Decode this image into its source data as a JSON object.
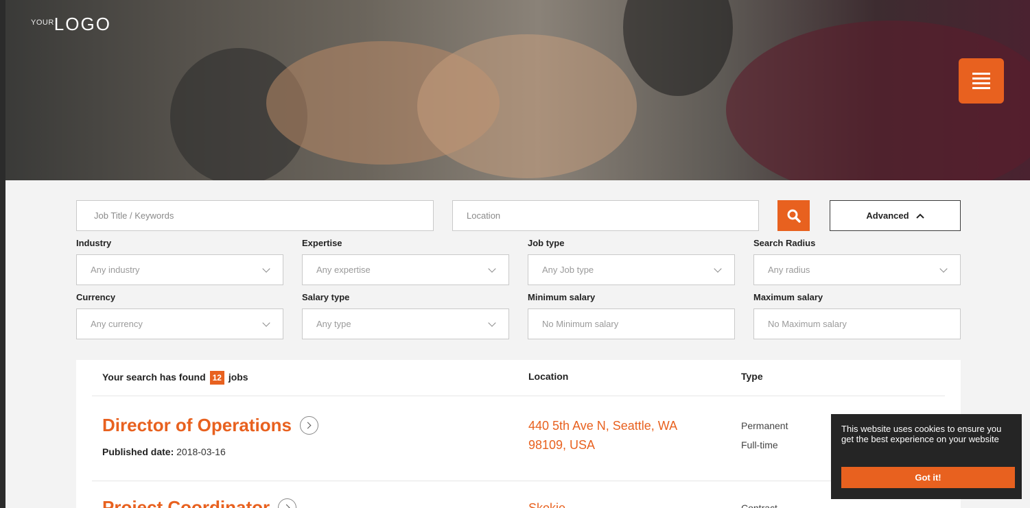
{
  "brand": {
    "logo_small": "YOUR",
    "logo_main": "LOGO",
    "accent": "#e8611f"
  },
  "search": {
    "keywords_placeholder": "Job Title / Keywords",
    "location_placeholder": "Location",
    "advanced_label": "Advanced"
  },
  "filters": [
    {
      "label": "Industry",
      "value": "Any industry",
      "type": "select"
    },
    {
      "label": "Expertise",
      "value": "Any expertise",
      "type": "select"
    },
    {
      "label": "Job type",
      "value": "Any Job type",
      "type": "select"
    },
    {
      "label": "Search Radius",
      "value": "Any radius",
      "type": "select"
    },
    {
      "label": "Currency",
      "value": "Any currency",
      "type": "select"
    },
    {
      "label": "Salary type",
      "value": "Any type",
      "type": "select"
    },
    {
      "label": "Minimum salary",
      "value": "No Minimum salary",
      "type": "input"
    },
    {
      "label": "Maximum salary",
      "value": "No Maximum salary",
      "type": "input"
    }
  ],
  "results": {
    "found_prefix": "Your search has found",
    "count": "12",
    "found_suffix": "jobs",
    "col_location": "Location",
    "col_type": "Type",
    "jobs": [
      {
        "title": "Director of Operations",
        "published_label": "Published date:",
        "published_date": "2018-03-16",
        "location": "440 5th Ave N, Seattle, WA 98109, USA",
        "type_1": "Permanent",
        "type_2": "Full-time"
      },
      {
        "title": "Project Coordinator",
        "location": "Skokie",
        "type_1": "Contract"
      }
    ]
  },
  "cookie": {
    "message": "This website uses cookies to ensure you get the best experience on your website",
    "button": "Got it!"
  }
}
